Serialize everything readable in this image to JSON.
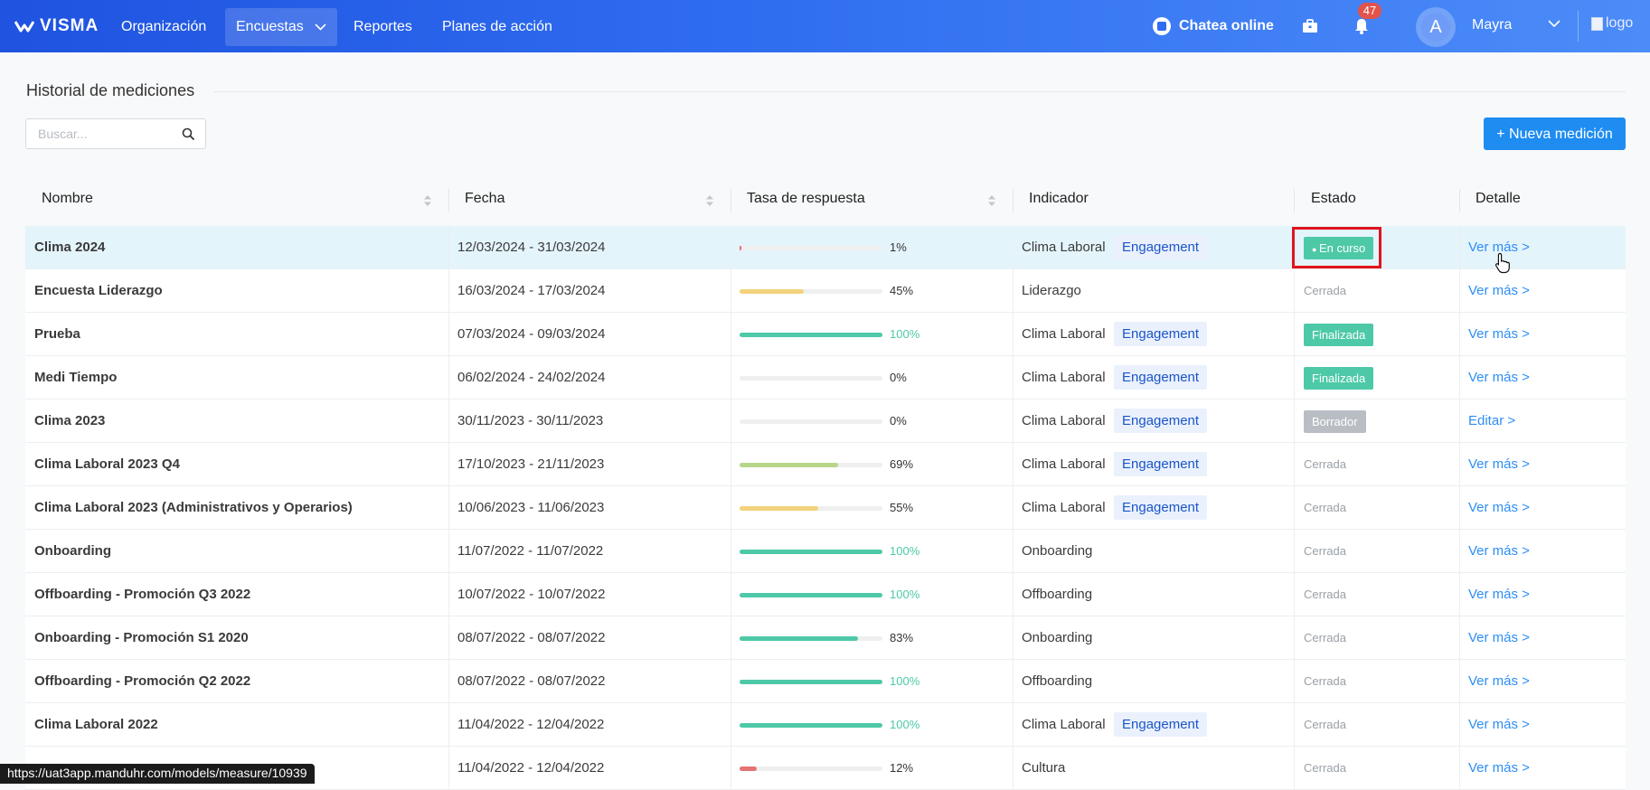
{
  "nav": {
    "brand": "VISMA",
    "items": [
      {
        "label": "Organización"
      },
      {
        "label": "Encuestas"
      },
      {
        "label": "Reportes"
      },
      {
        "label": "Planes de acción"
      }
    ],
    "chat_label": "Chatea online",
    "notifications_count": "47",
    "avatar_initial": "A",
    "user_name": "Mayra",
    "logo_alt": "logo"
  },
  "page": {
    "title": "Historial de mediciones",
    "search_placeholder": "Buscar...",
    "new_button": "+ Nueva medición"
  },
  "table": {
    "columns": [
      "Nombre",
      "Fecha",
      "Tasa de respuesta",
      "Indicador",
      "Estado",
      "Detalle"
    ],
    "rows": [
      {
        "name": "Clima 2024",
        "date": "12/03/2024 - 31/03/2024",
        "rate": 1,
        "rate_label": "1%",
        "indicator": "Clima Laboral",
        "tag": "Engagement",
        "status": "En curso",
        "status_style": "pill-green-dot",
        "detail": "Ver más >"
      },
      {
        "name": "Encuesta Liderazgo",
        "date": "16/03/2024 - 17/03/2024",
        "rate": 45,
        "rate_label": "45%",
        "indicator": "Liderazgo",
        "tag": "",
        "status": "Cerrada",
        "status_style": "plain",
        "detail": "Ver más >"
      },
      {
        "name": "Prueba",
        "date": "07/03/2024 - 09/03/2024",
        "rate": 100,
        "rate_label": "100%",
        "indicator": "Clima Laboral",
        "tag": "Engagement",
        "status": "Finalizada",
        "status_style": "pill-green",
        "detail": "Ver más >"
      },
      {
        "name": "Medi Tiempo",
        "date": "06/02/2024 - 24/02/2024",
        "rate": 0,
        "rate_label": "0%",
        "indicator": "Clima Laboral",
        "tag": "Engagement",
        "status": "Finalizada",
        "status_style": "pill-green",
        "detail": "Ver más >"
      },
      {
        "name": "Clima 2023",
        "date": "30/11/2023 - 30/11/2023",
        "rate": 0,
        "rate_label": "0%",
        "indicator": "Clima Laboral",
        "tag": "Engagement",
        "status": "Borrador",
        "status_style": "pill-gray",
        "detail": "Editar >"
      },
      {
        "name": "Clima Laboral 2023 Q4",
        "date": "17/10/2023 - 21/11/2023",
        "rate": 69,
        "rate_label": "69%",
        "indicator": "Clima Laboral",
        "tag": "Engagement",
        "status": "Cerrada",
        "status_style": "plain",
        "detail": "Ver más >"
      },
      {
        "name": "Clima Laboral 2023 (Administrativos y Operarios)",
        "date": "10/06/2023 - 11/06/2023",
        "rate": 55,
        "rate_label": "55%",
        "indicator": "Clima Laboral",
        "tag": "Engagement",
        "status": "Cerrada",
        "status_style": "plain",
        "detail": "Ver más >"
      },
      {
        "name": "Onboarding",
        "date": "11/07/2022 - 11/07/2022",
        "rate": 100,
        "rate_label": "100%",
        "indicator": "Onboarding",
        "tag": "",
        "status": "Cerrada",
        "status_style": "plain",
        "detail": "Ver más >"
      },
      {
        "name": "Offboarding - Promoción Q3 2022",
        "date": "10/07/2022 - 10/07/2022",
        "rate": 100,
        "rate_label": "100%",
        "indicator": "Offboarding",
        "tag": "",
        "status": "Cerrada",
        "status_style": "plain",
        "detail": "Ver más >"
      },
      {
        "name": "Onboarding - Promoción S1 2020",
        "date": "08/07/2022 - 08/07/2022",
        "rate": 83,
        "rate_label": "83%",
        "indicator": "Onboarding",
        "tag": "",
        "status": "Cerrada",
        "status_style": "plain",
        "detail": "Ver más >"
      },
      {
        "name": "Offboarding - Promoción Q2 2022",
        "date": "08/07/2022 - 08/07/2022",
        "rate": 100,
        "rate_label": "100%",
        "indicator": "Offboarding",
        "tag": "",
        "status": "Cerrada",
        "status_style": "plain",
        "detail": "Ver más >"
      },
      {
        "name": "Clima Laboral 2022",
        "date": "11/04/2022 - 12/04/2022",
        "rate": 100,
        "rate_label": "100%",
        "indicator": "Clima Laboral",
        "tag": "Engagement",
        "status": "Cerrada",
        "status_style": "plain",
        "detail": "Ver más >"
      },
      {
        "name": "",
        "date": "11/04/2022 - 12/04/2022",
        "rate": 12,
        "rate_label": "12%",
        "indicator": "Cultura",
        "tag": "",
        "status": "Cerrada",
        "status_style": "plain",
        "detail": "Ver más >"
      }
    ]
  },
  "status_url": "https://uat3app.manduhr.com/models/measure/10939",
  "colors": {
    "accent": "#1e8cf1",
    "bar_full": "#4ec9a8",
    "bar_mid": "#f2d27a",
    "bar_good": "#b7d68a",
    "bar_low": "#e57373",
    "status_green": "#4ec9a8",
    "status_gray": "#b9bec4",
    "tag_bg": "#eaf1fd",
    "tag_text": "#1b55c8"
  }
}
